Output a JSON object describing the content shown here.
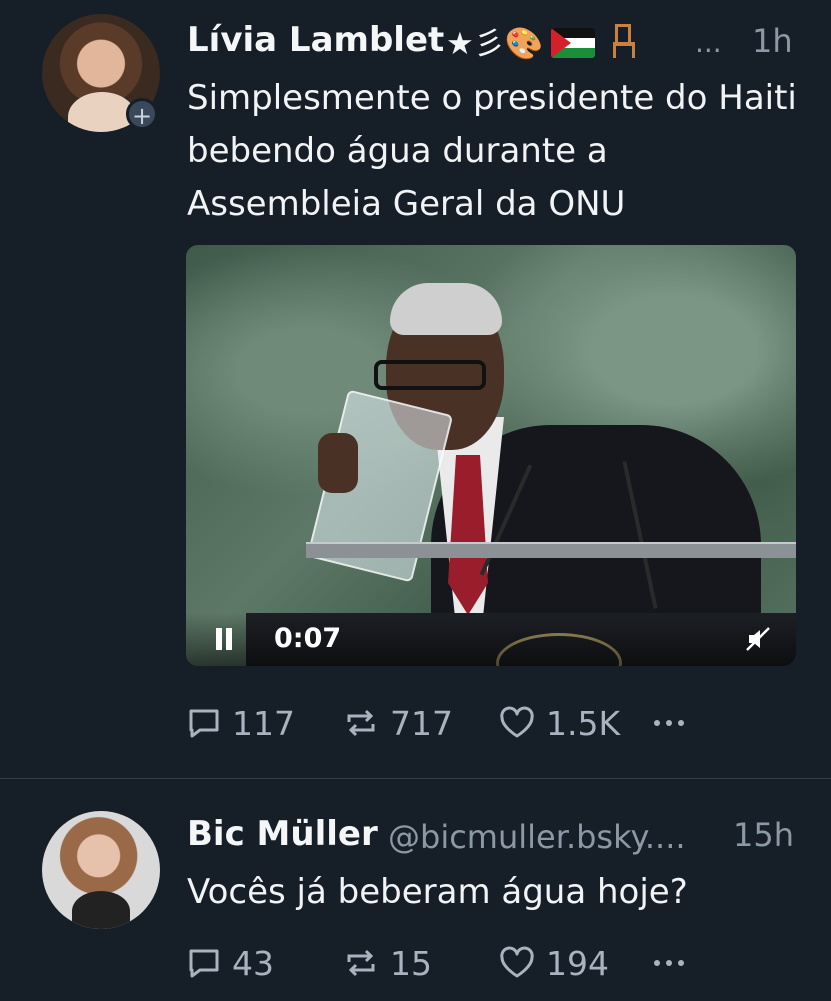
{
  "posts": [
    {
      "author": "Lívia Lamblet",
      "name_decor": "★彡🎨",
      "truncation": "...",
      "time": "1h",
      "follow_label": "+",
      "text": "Simplesmente o presidente do Haiti bebendo água durante a Assembleia Geral da ONU",
      "video": {
        "elapsed": "0:07",
        "state": "playing",
        "muted": true
      },
      "counts": {
        "replies": "117",
        "reposts": "717",
        "likes": "1.5K"
      }
    },
    {
      "author": "Bic Müller",
      "handle": "@bicmuller.bsky....",
      "time": "15h",
      "text": "Vocês já beberam água hoje?",
      "counts": {
        "replies": "43",
        "reposts": "15",
        "likes": "194"
      }
    }
  ],
  "icons": {
    "reply": "speech-bubble-icon",
    "repost": "repost-arrows-icon",
    "like": "heart-icon",
    "more": "more-dots-icon",
    "pause": "pause-icon",
    "mute": "muted-speaker-icon"
  },
  "colors": {
    "background": "#161e27",
    "text": "#f1f3f5",
    "muted": "#8b98a5",
    "action": "#a8b3bf"
  }
}
